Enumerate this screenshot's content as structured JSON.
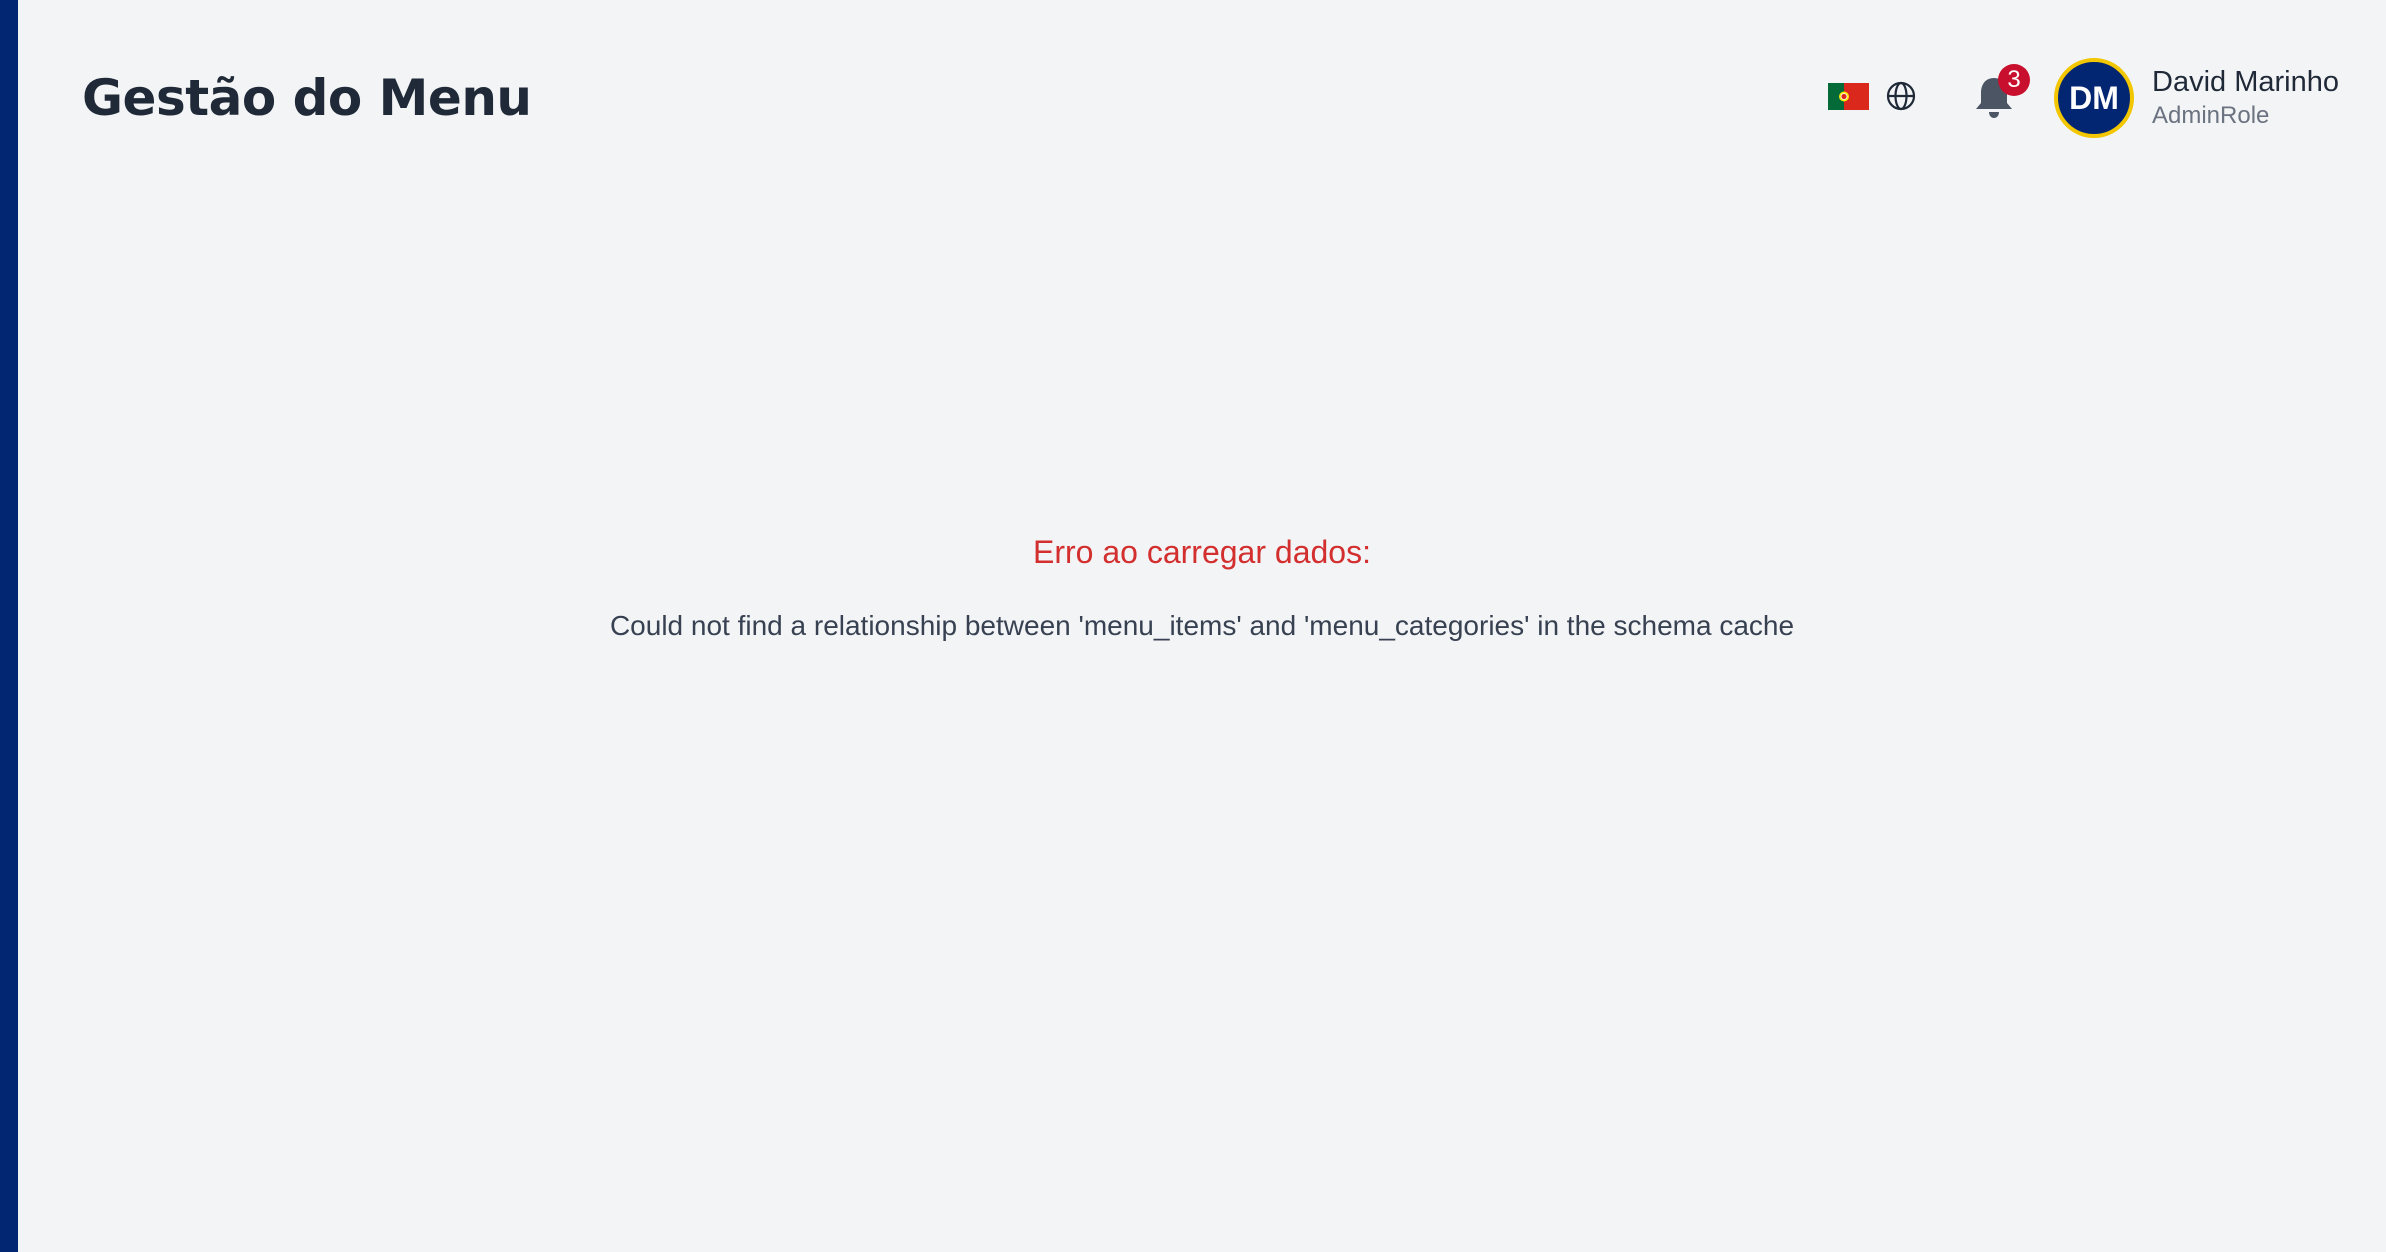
{
  "header": {
    "title": "Gestão do Menu",
    "language": {
      "flag_icon": "portugal-flag-icon",
      "globe_icon": "globe-icon"
    },
    "notifications": {
      "icon": "bell-icon",
      "count": "3"
    },
    "user": {
      "initials": "DM",
      "name": "David Marinho",
      "role": "AdminRole"
    }
  },
  "error": {
    "title": "Erro ao carregar dados:",
    "message": "Could not find a relationship between 'menu_items' and 'menu_categories' in the schema cache"
  },
  "colors": {
    "sidebar_accent": "#032672",
    "background": "#f3f4f6",
    "avatar_bg": "#032672",
    "avatar_ring": "#f2c600",
    "badge": "#c8102e",
    "error_text": "#d32f2f"
  }
}
